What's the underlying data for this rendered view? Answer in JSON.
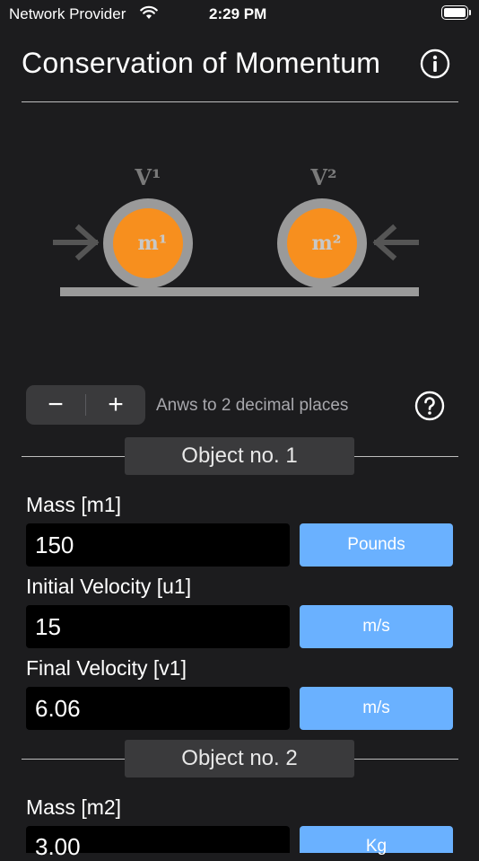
{
  "status_bar": {
    "carrier": "Network Provider",
    "time": "2:29 PM"
  },
  "header": {
    "title": "Conservation of Momentum"
  },
  "diagram": {
    "v1_label": "V¹",
    "v2_label": "V²",
    "m1_label": "m¹",
    "m2_label": "m²",
    "ball_color": "#f78f1e",
    "rim_color": "#9a9a9a"
  },
  "controls": {
    "minus_label": "−",
    "plus_label": "+",
    "hint": "Anws to 2 decimal places"
  },
  "object1": {
    "header": "Object no. 1",
    "mass_label": "Mass [m1]",
    "mass_value": "150",
    "mass_unit": "Pounds",
    "u_label": "Initial Velocity [u1]",
    "u_value": "15",
    "u_unit": "m/s",
    "v_label": "Final Velocity [v1]",
    "v_value": "6.06",
    "v_unit": "m/s"
  },
  "object2": {
    "header": "Object no. 2",
    "mass_label": "Mass [m2]",
    "mass_value": "3.00",
    "mass_unit": "Kg"
  },
  "colors": {
    "background": "#1c1c1e",
    "accent": "#6ab1ff"
  }
}
